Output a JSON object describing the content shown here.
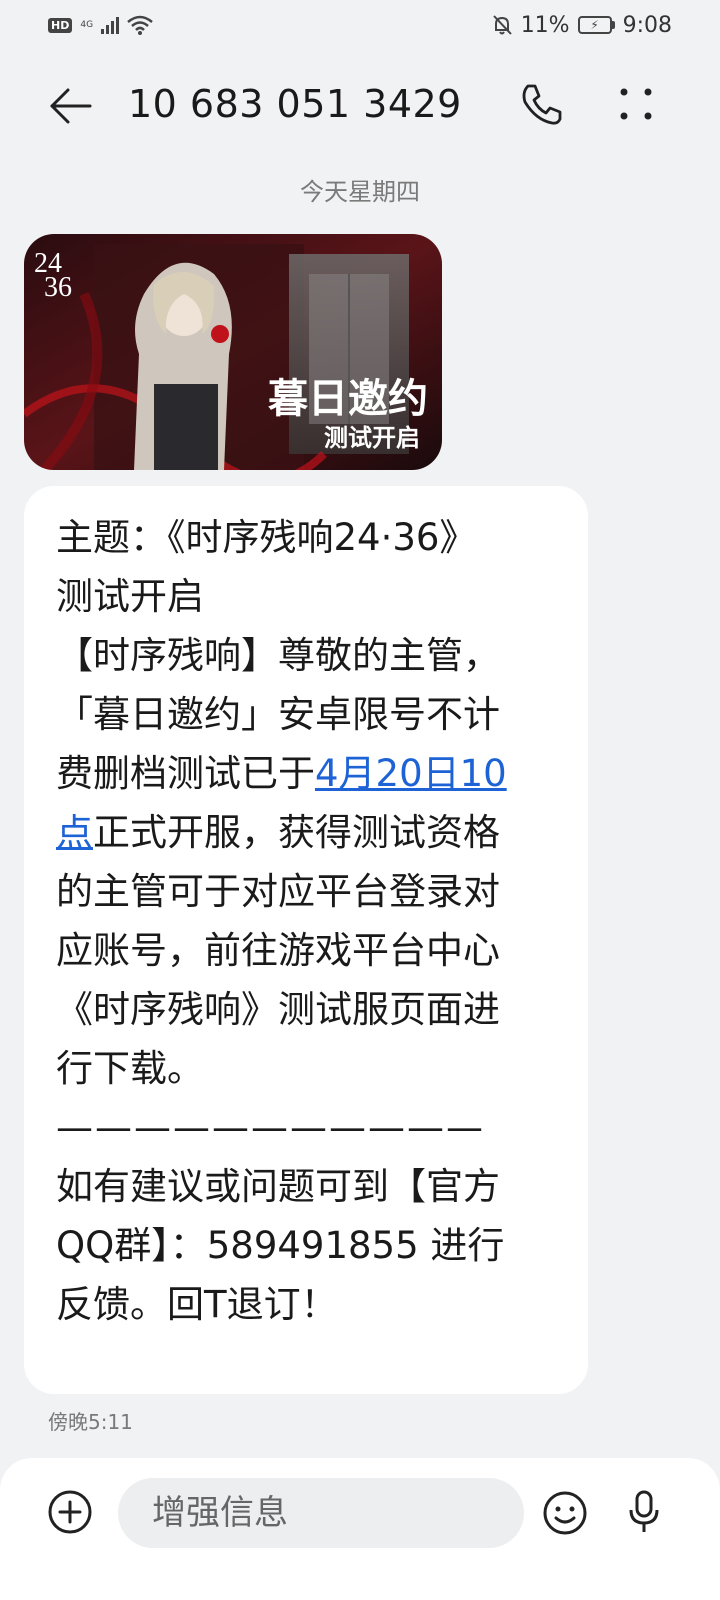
{
  "status": {
    "hd": "HD",
    "network": "4G",
    "battery_percent": "11%",
    "time": "9:08"
  },
  "header": {
    "contact_number": "10 683 051 3429"
  },
  "date_separator": "今天星期四",
  "image": {
    "logo_top": "24",
    "logo_bottom": "36",
    "headline": "暮日邀约",
    "subheadline": "测试开启"
  },
  "message": {
    "lines": [
      "主题：《时序残响24·36》",
      "测试开启",
      "【时序残响】尊敬的主管，",
      "「暮日邀约」安卓限号不计",
      "费删档测试已于"
    ],
    "link_part1": "4月20日10",
    "link_part2": "点",
    "after_link": "正式开服，获得测试资格",
    "lines2": [
      "的主管可于对应平台登录对",
      "应账号，前往游戏平台中心",
      "《时序残响》测试服页面进",
      "行下载。",
      "———————————",
      "如有建议或问题可到【官方",
      "QQ群】：589491855 进行",
      "反馈。回T退订！"
    ],
    "time": "傍晚5:11"
  },
  "composer": {
    "placeholder": "增强信息"
  },
  "colors": {
    "background": "#f1f2f4",
    "bubble": "#ffffff",
    "link": "#1e63d6"
  }
}
